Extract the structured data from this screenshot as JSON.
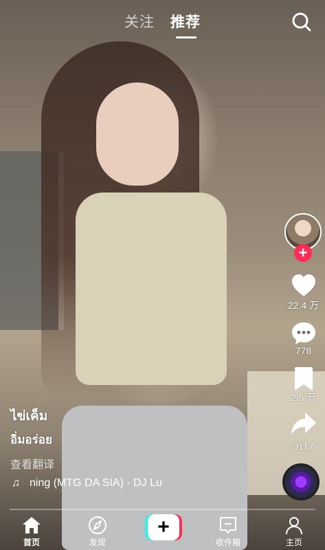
{
  "header": {
    "tabs": [
      {
        "label": "关注",
        "active": false
      },
      {
        "label": "推荐",
        "active": true
      }
    ],
    "search_icon": "search-icon"
  },
  "sidebar": {
    "follow_icon": "plus-icon",
    "like_count": "22.4 万",
    "comment_count": "778",
    "favorite_count": "2.5 万",
    "share_count": "9117"
  },
  "caption": {
    "line1": "ไข่เค็ม",
    "line2": "อิ่มอร่อย",
    "translate_label": "查看翻译",
    "music_text": "ning (MTG DA SIA) - DJ Lu"
  },
  "progress": {
    "fraction": 0.0
  },
  "bottom_nav": {
    "home": "首页",
    "discover": "发现",
    "create_symbol": "+",
    "inbox": "收件箱",
    "profile": "主页"
  },
  "colors": {
    "accent_red": "#fe2c55",
    "accent_cyan": "#25f4ee"
  }
}
